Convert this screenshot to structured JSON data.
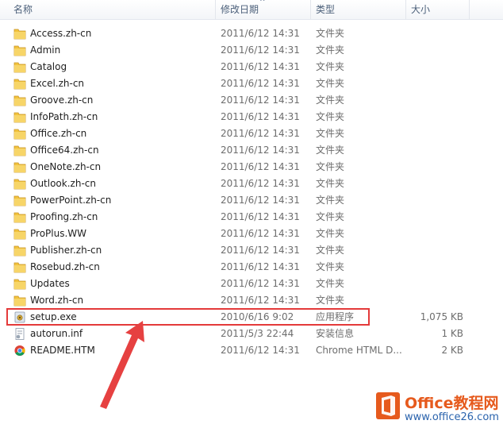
{
  "header": {
    "name": "名称",
    "date": "修改日期",
    "type": "类型",
    "size": "大小",
    "sort_indicator": "^"
  },
  "files": [
    {
      "icon": "folder-icon",
      "name": "Access.zh-cn",
      "date": "2011/6/12 14:31",
      "type": "文件夹",
      "size": ""
    },
    {
      "icon": "folder-icon",
      "name": "Admin",
      "date": "2011/6/12 14:31",
      "type": "文件夹",
      "size": ""
    },
    {
      "icon": "folder-icon",
      "name": "Catalog",
      "date": "2011/6/12 14:31",
      "type": "文件夹",
      "size": ""
    },
    {
      "icon": "folder-icon",
      "name": "Excel.zh-cn",
      "date": "2011/6/12 14:31",
      "type": "文件夹",
      "size": ""
    },
    {
      "icon": "folder-icon",
      "name": "Groove.zh-cn",
      "date": "2011/6/12 14:31",
      "type": "文件夹",
      "size": ""
    },
    {
      "icon": "folder-icon",
      "name": "InfoPath.zh-cn",
      "date": "2011/6/12 14:31",
      "type": "文件夹",
      "size": ""
    },
    {
      "icon": "folder-icon",
      "name": "Office.zh-cn",
      "date": "2011/6/12 14:31",
      "type": "文件夹",
      "size": ""
    },
    {
      "icon": "folder-icon",
      "name": "Office64.zh-cn",
      "date": "2011/6/12 14:31",
      "type": "文件夹",
      "size": ""
    },
    {
      "icon": "folder-icon",
      "name": "OneNote.zh-cn",
      "date": "2011/6/12 14:31",
      "type": "文件夹",
      "size": ""
    },
    {
      "icon": "folder-icon",
      "name": "Outlook.zh-cn",
      "date": "2011/6/12 14:31",
      "type": "文件夹",
      "size": ""
    },
    {
      "icon": "folder-icon",
      "name": "PowerPoint.zh-cn",
      "date": "2011/6/12 14:31",
      "type": "文件夹",
      "size": ""
    },
    {
      "icon": "folder-icon",
      "name": "Proofing.zh-cn",
      "date": "2011/6/12 14:31",
      "type": "文件夹",
      "size": ""
    },
    {
      "icon": "folder-icon",
      "name": "ProPlus.WW",
      "date": "2011/6/12 14:31",
      "type": "文件夹",
      "size": ""
    },
    {
      "icon": "folder-icon",
      "name": "Publisher.zh-cn",
      "date": "2011/6/12 14:31",
      "type": "文件夹",
      "size": ""
    },
    {
      "icon": "folder-icon",
      "name": "Rosebud.zh-cn",
      "date": "2011/6/12 14:31",
      "type": "文件夹",
      "size": ""
    },
    {
      "icon": "folder-icon",
      "name": "Updates",
      "date": "2011/6/12 14:31",
      "type": "文件夹",
      "size": ""
    },
    {
      "icon": "folder-icon",
      "name": "Word.zh-cn",
      "date": "2011/6/12 14:31",
      "type": "文件夹",
      "size": ""
    },
    {
      "icon": "setup-exe-icon",
      "name": "setup.exe",
      "date": "2010/6/16 9:02",
      "type": "应用程序",
      "size": "1,075 KB"
    },
    {
      "icon": "inf-file-icon",
      "name": "autorun.inf",
      "date": "2011/5/3 22:44",
      "type": "安装信息",
      "size": "1 KB"
    },
    {
      "icon": "chrome-html-icon",
      "name": "README.HTM",
      "date": "2011/6/12 14:31",
      "type": "Chrome HTML D...",
      "size": "2 KB"
    }
  ],
  "watermark": {
    "title": "Office教程网",
    "url": "www.office26.com"
  },
  "colors": {
    "folder": "#f2c33d",
    "highlight": "#e43a3a",
    "watermark_orange": "#e65a1d",
    "watermark_blue": "#2a63ad"
  }
}
